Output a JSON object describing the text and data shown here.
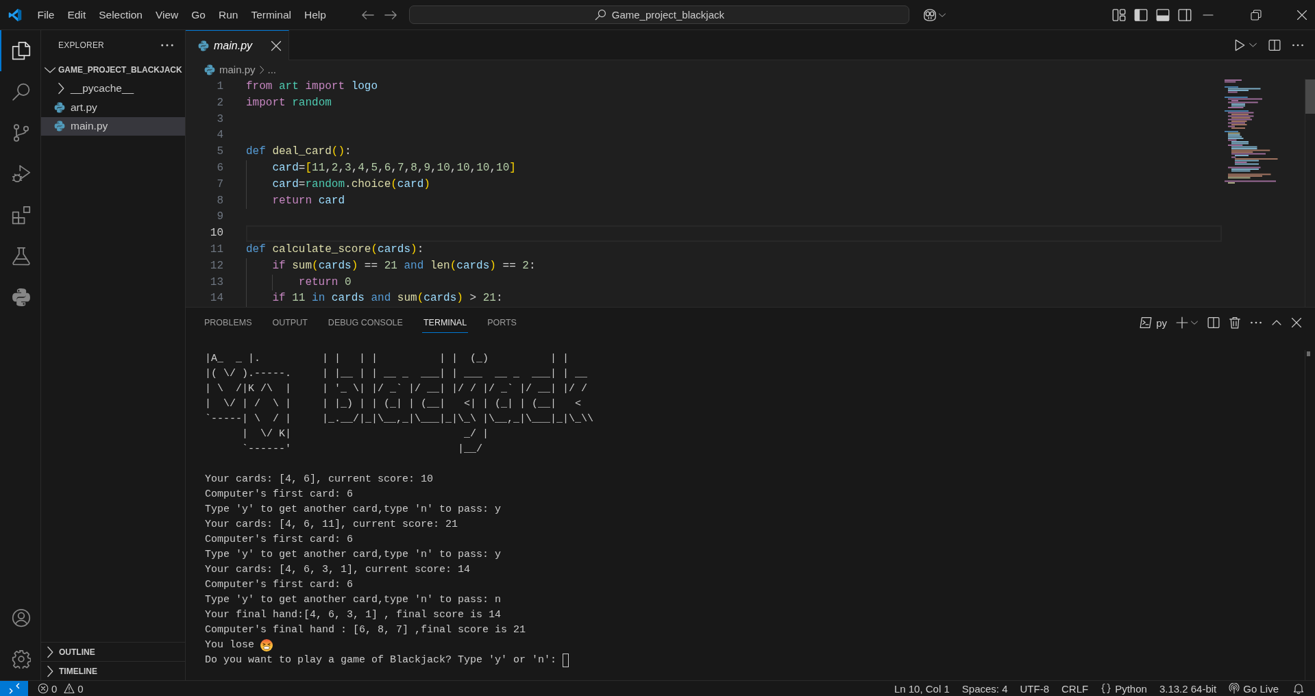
{
  "title_bar": {
    "menu": [
      "File",
      "Edit",
      "Selection",
      "View",
      "Go",
      "Run",
      "Terminal",
      "Help"
    ],
    "command_center": "Game_project_blackjack"
  },
  "activity_bar": {
    "items": [
      {
        "kind": "explorer",
        "selected": true
      },
      {
        "kind": "search",
        "selected": false
      },
      {
        "kind": "source_control",
        "selected": false
      },
      {
        "kind": "run_debug",
        "selected": false
      },
      {
        "kind": "extensions",
        "selected": false
      },
      {
        "kind": "testing",
        "selected": false
      },
      {
        "kind": "python",
        "selected": false
      }
    ],
    "bottom": [
      {
        "kind": "accounts"
      },
      {
        "kind": "manage"
      }
    ]
  },
  "sidebar": {
    "title": "EXPLORER",
    "tree": [
      {
        "label": "GAME_PROJECT_BLACKJACK",
        "expanded": true,
        "children": [
          {
            "label": "__pycache__",
            "kind": "folder",
            "expanded": false,
            "selected": false
          },
          {
            "label": "art.py",
            "kind": "python",
            "selected": false
          },
          {
            "label": "main.py",
            "kind": "python",
            "selected": true
          }
        ]
      }
    ],
    "sections": [
      {
        "label": "OUTLINE",
        "expanded": false
      },
      {
        "label": "TIMELINE",
        "expanded": false
      }
    ]
  },
  "editor": {
    "tabs": [
      {
        "label": "main.py",
        "selected": true,
        "preview": true
      }
    ],
    "breadcrumbs": [
      {
        "label": "main.py",
        "kind": "python"
      },
      {
        "label": "...",
        "kind": "text"
      }
    ],
    "lines": [
      {
        "number": "1",
        "current": false,
        "tokens": [
          {
            "text": "from ",
            "kind": "control"
          },
          {
            "text": "art ",
            "kind": "module"
          },
          {
            "text": "import ",
            "kind": "control"
          },
          {
            "text": "logo",
            "kind": "variable"
          }
        ]
      },
      {
        "number": "2",
        "current": false,
        "tokens": [
          {
            "text": "import ",
            "kind": "control"
          },
          {
            "text": "random",
            "kind": "module"
          }
        ]
      },
      {
        "number": "3",
        "current": false
      },
      {
        "number": "4",
        "current": false
      },
      {
        "number": "5",
        "current": false,
        "tokens": [
          {
            "text": "def ",
            "kind": "keyword"
          },
          {
            "text": "deal_card",
            "kind": "function"
          },
          {
            "text": "()",
            "kind": "bracket"
          },
          {
            "text": ":",
            "kind": "plain"
          }
        ]
      },
      {
        "number": "6",
        "current": false,
        "tokens": [
          {
            "text": "    card",
            "kind": "variable"
          },
          {
            "text": "=",
            "kind": "plain"
          },
          {
            "text": "[",
            "kind": "bracket"
          },
          {
            "text": "11",
            "kind": "number"
          },
          {
            "text": ",",
            "kind": "plain"
          },
          {
            "text": "2",
            "kind": "number"
          },
          {
            "text": ",",
            "kind": "plain"
          },
          {
            "text": "3",
            "kind": "number"
          },
          {
            "text": ",",
            "kind": "plain"
          },
          {
            "text": "4",
            "kind": "number"
          },
          {
            "text": ",",
            "kind": "plain"
          },
          {
            "text": "5",
            "kind": "number"
          },
          {
            "text": ",",
            "kind": "plain"
          },
          {
            "text": "6",
            "kind": "number"
          },
          {
            "text": ",",
            "kind": "plain"
          },
          {
            "text": "7",
            "kind": "number"
          },
          {
            "text": ",",
            "kind": "plain"
          },
          {
            "text": "8",
            "kind": "number"
          },
          {
            "text": ",",
            "kind": "plain"
          },
          {
            "text": "9",
            "kind": "number"
          },
          {
            "text": ",",
            "kind": "plain"
          },
          {
            "text": "10",
            "kind": "number"
          },
          {
            "text": ",",
            "kind": "plain"
          },
          {
            "text": "10",
            "kind": "number"
          },
          {
            "text": ",",
            "kind": "plain"
          },
          {
            "text": "10",
            "kind": "number"
          },
          {
            "text": ",",
            "kind": "plain"
          },
          {
            "text": "10",
            "kind": "number"
          },
          {
            "text": "]",
            "kind": "bracket"
          }
        ]
      },
      {
        "number": "7",
        "current": false,
        "tokens": [
          {
            "text": "    card",
            "kind": "variable"
          },
          {
            "text": "=",
            "kind": "plain"
          },
          {
            "text": "random",
            "kind": "module"
          },
          {
            "text": ".",
            "kind": "plain"
          },
          {
            "text": "choice",
            "kind": "function"
          },
          {
            "text": "(",
            "kind": "bracket"
          },
          {
            "text": "card",
            "kind": "variable"
          },
          {
            "text": ")",
            "kind": "bracket"
          }
        ]
      },
      {
        "number": "8",
        "current": false,
        "tokens": [
          {
            "text": "    return ",
            "kind": "control"
          },
          {
            "text": "card",
            "kind": "variable"
          }
        ]
      },
      {
        "number": "9",
        "current": false
      },
      {
        "number": "10",
        "current": true
      },
      {
        "number": "11",
        "current": false,
        "tokens": [
          {
            "text": "def ",
            "kind": "keyword"
          },
          {
            "text": "calculate_score",
            "kind": "function"
          },
          {
            "text": "(",
            "kind": "bracket"
          },
          {
            "text": "cards",
            "kind": "variable"
          },
          {
            "text": ")",
            "kind": "bracket"
          },
          {
            "text": ":",
            "kind": "plain"
          }
        ]
      },
      {
        "number": "12",
        "current": false,
        "tokens": [
          {
            "text": "    if ",
            "kind": "control"
          },
          {
            "text": "sum",
            "kind": "function"
          },
          {
            "text": "(",
            "kind": "bracket"
          },
          {
            "text": "cards",
            "kind": "variable"
          },
          {
            "text": ")",
            "kind": "bracket"
          },
          {
            "text": " == ",
            "kind": "plain"
          },
          {
            "text": "21",
            "kind": "number"
          },
          {
            "text": " and ",
            "kind": "keyword"
          },
          {
            "text": "len",
            "kind": "function"
          },
          {
            "text": "(",
            "kind": "bracket"
          },
          {
            "text": "cards",
            "kind": "variable"
          },
          {
            "text": ")",
            "kind": "bracket"
          },
          {
            "text": " == ",
            "kind": "plain"
          },
          {
            "text": "2",
            "kind": "number"
          },
          {
            "text": ":",
            "kind": "plain"
          }
        ]
      },
      {
        "number": "13",
        "current": false,
        "tokens": [
          {
            "text": "        return ",
            "kind": "control"
          },
          {
            "text": "0",
            "kind": "number"
          }
        ]
      },
      {
        "number": "14",
        "current": false,
        "tokens": [
          {
            "text": "    if ",
            "kind": "control"
          },
          {
            "text": "11",
            "kind": "number"
          },
          {
            "text": " in ",
            "kind": "keyword"
          },
          {
            "text": "cards",
            "kind": "variable"
          },
          {
            "text": " and ",
            "kind": "keyword"
          },
          {
            "text": "sum",
            "kind": "function"
          },
          {
            "text": "(",
            "kind": "bracket"
          },
          {
            "text": "cards",
            "kind": "variable"
          },
          {
            "text": ")",
            "kind": "bracket"
          },
          {
            "text": " > ",
            "kind": "plain"
          },
          {
            "text": "21",
            "kind": "number"
          },
          {
            "text": ":",
            "kind": "plain"
          }
        ]
      }
    ]
  },
  "panel": {
    "tabs": [
      {
        "label": "PROBLEMS",
        "selected": false
      },
      {
        "label": "OUTPUT",
        "selected": false
      },
      {
        "label": "DEBUG CONSOLE",
        "selected": false
      },
      {
        "label": "TERMINAL",
        "selected": true
      },
      {
        "label": "PORTS",
        "selected": false
      }
    ],
    "terminal": {
      "profile": "py",
      "art": [
        "|A_  _ |.          | |   | |          | |  (_)          | |",
        "|( \\/ ).-----.     | |__ | | __ _  ___| | ___  __ _  ___| | __",
        "| \\  /|K /\\  |     | '_ \\| |/ _` |/ __| |/ / |/ _` |/ __| |/ /",
        "|  \\/ | /  \\ |     | |_) | | (_| | (__|   <| | (_| | (__|   <",
        "`-----| \\  / |     |_.__/|_|\\__,_|\\___|_|\\_\\ |\\__,_|\\___|_|\\_\\\\",
        "      |  \\/ K|                            _/ |",
        "      `------'                           |__/"
      ],
      "output": [
        {
          "text": "Your cards: [4, 6], current score: 10",
          "kind": "text"
        },
        {
          "text": "Computer's first card: 6",
          "kind": "text"
        },
        {
          "text": "Type 'y' to get another card,type 'n' to pass: y",
          "kind": "text"
        },
        {
          "text": "Your cards: [4, 6, 11], current score: 21",
          "kind": "text"
        },
        {
          "text": "Computer's first card: 6",
          "kind": "text"
        },
        {
          "text": "Type 'y' to get another card,type 'n' to pass: y",
          "kind": "text"
        },
        {
          "text": "Your cards: [4, 6, 3, 1], current score: 14",
          "kind": "text"
        },
        {
          "text": "Computer's first card: 6",
          "kind": "text"
        },
        {
          "text": "Type 'y' to get another card,type 'n' to pass: n",
          "kind": "text"
        },
        {
          "text": "Your final hand:[4, 6, 3, 1] , final score is 14",
          "kind": "text"
        },
        {
          "text": "Computer's final hand : [6, 8, 7] ,final score is 21",
          "kind": "text"
        },
        {
          "text": "You lose",
          "kind": "face"
        },
        {
          "text": "Do you want to play a game of Blackjack? Type 'y' or 'n':",
          "kind": "prompt"
        }
      ]
    }
  },
  "status_bar": {
    "problems": {
      "errors": "0",
      "warnings": "0"
    },
    "items": [
      {
        "text": "Ln 10, Col 1",
        "kind": "text"
      },
      {
        "text": "Spaces: 4",
        "kind": "text"
      },
      {
        "text": "UTF-8",
        "kind": "text"
      },
      {
        "text": "CRLF",
        "kind": "text"
      },
      {
        "text": "Python",
        "kind": "language"
      },
      {
        "text": "3.13.2 64-bit",
        "kind": "text"
      },
      {
        "text": "Go Live",
        "kind": "live"
      }
    ]
  }
}
